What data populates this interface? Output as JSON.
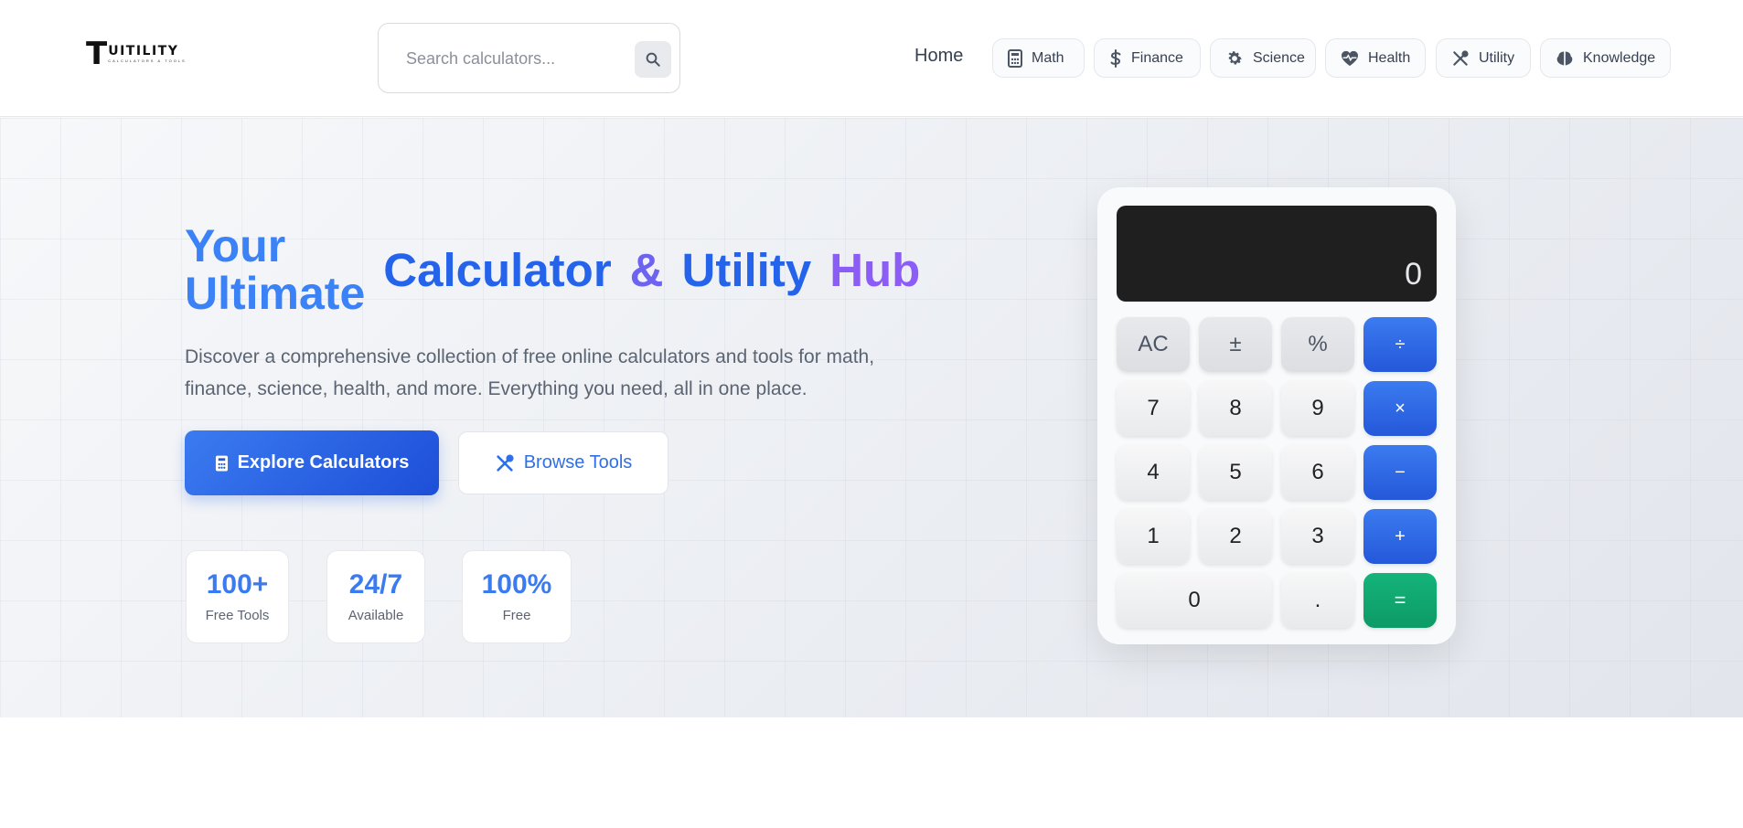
{
  "brand": {
    "logo_mark": "T",
    "logo_text": "UITILITY",
    "logo_tagline": "CALCULATORS & TOOLS"
  },
  "search": {
    "placeholder": "Search calculators...",
    "icon": "search-icon"
  },
  "nav": {
    "home_label": "Home",
    "pills": [
      {
        "label": "Math",
        "icon": "calculator-icon"
      },
      {
        "label": "Finance",
        "icon": "dollar-icon"
      },
      {
        "label": "Science",
        "icon": "gear-icon"
      },
      {
        "label": "Health",
        "icon": "heartbeat-icon"
      },
      {
        "label": "Utility",
        "icon": "tools-icon"
      },
      {
        "label": "Knowledge",
        "icon": "brain-icon"
      }
    ]
  },
  "hero": {
    "title_line1": "Your",
    "title_line2": "Ultimate",
    "title_word1": "Calculator",
    "title_word2": "&",
    "title_word3": "Utility",
    "title_word4": "Hub",
    "description_line1": "Discover a comprehensive collection of free online calculators and tools for math,",
    "description_line2": "finance, science, health, and more. Everything you need, all in one place.",
    "primary_button": "Explore Calculators",
    "secondary_button": "Browse Tools",
    "stats": [
      {
        "value": "100+",
        "label": "Free Tools"
      },
      {
        "value": "24/7",
        "label": "Available"
      },
      {
        "value": "100%",
        "label": "Free"
      }
    ]
  },
  "calculator": {
    "display": "0",
    "keys": {
      "ac": "AC",
      "sign": "±",
      "percent": "%",
      "divide": "÷",
      "k7": "7",
      "k8": "8",
      "k9": "9",
      "multiply": "×",
      "k4": "4",
      "k5": "5",
      "k6": "6",
      "minus": "−",
      "k1": "1",
      "k2": "2",
      "k3": "3",
      "plus": "+",
      "k0": "0",
      "dot": ".",
      "equals": "="
    }
  },
  "colors": {
    "primary": "#2563eb",
    "primary_light": "#3b82f6",
    "accent_purple": "#8b5cf6",
    "equals_green": "#10a870",
    "display_bg": "#1f1f1f"
  }
}
